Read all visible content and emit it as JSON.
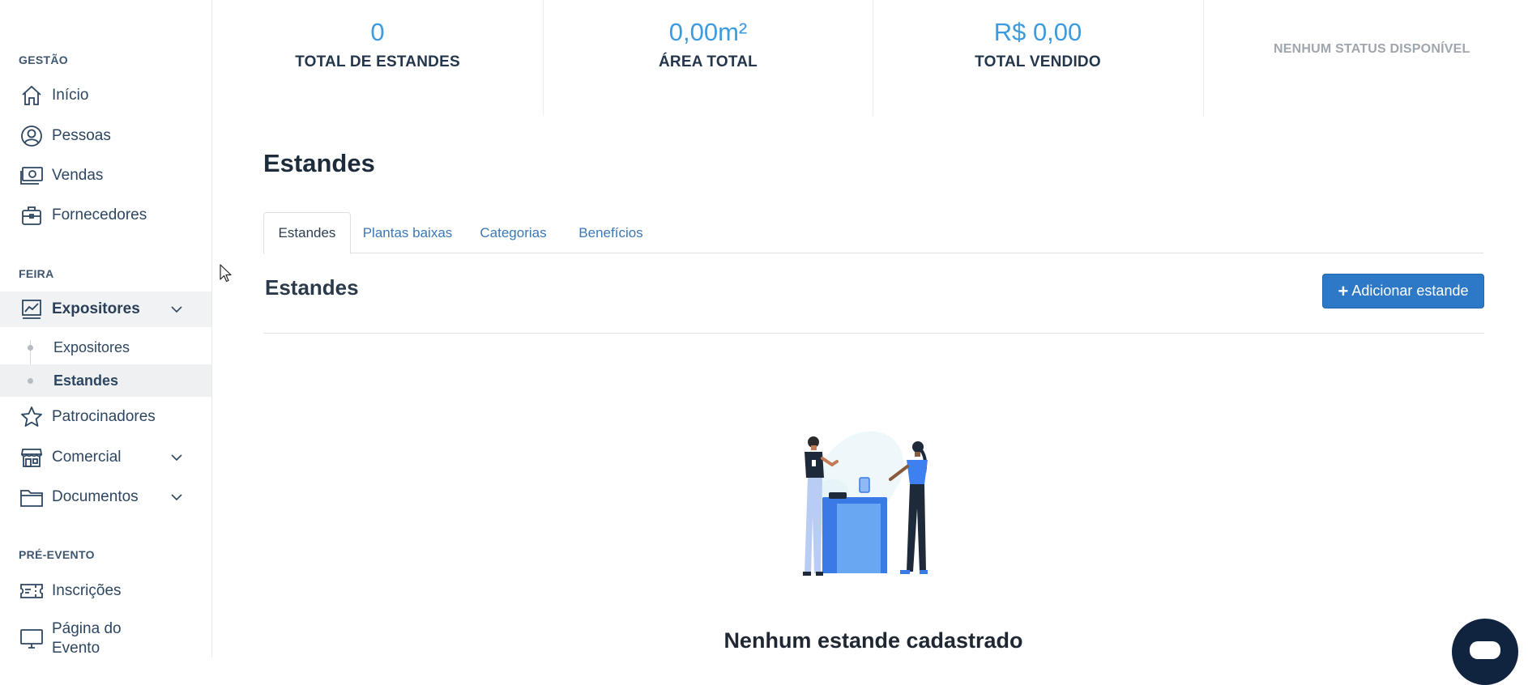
{
  "sidebar": {
    "sections": {
      "gestao": "GESTÃO",
      "feira": "FEIRA",
      "pre_evento": "PRÉ-EVENTO"
    },
    "items": {
      "inicio": "Início",
      "pessoas": "Pessoas",
      "vendas": "Vendas",
      "fornecedores": "Fornecedores",
      "expositores": "Expositores",
      "sub_expositores": "Expositores",
      "sub_estandes": "Estandes",
      "patrocinadores": "Patrocinadores",
      "comercial": "Comercial",
      "documentos": "Documentos",
      "inscricoes": "Inscrições",
      "pagina_line1": "Página do",
      "pagina_line2": "Evento"
    },
    "icons": {
      "inicio": "home-icon",
      "pessoas": "user-circle-icon",
      "vendas": "money-icon",
      "fornecedores": "briefcase-icon",
      "expositores": "chart-icon",
      "patrocinadores": "star-icon",
      "comercial": "store-icon",
      "documentos": "folder-icon",
      "inscricoes": "ticket-icon",
      "pagina": "monitor-icon"
    }
  },
  "stats": {
    "estandes": {
      "value": "0",
      "caption": "TOTAL DE ESTANDES"
    },
    "area": {
      "value": "0,00m²",
      "caption": "ÁREA TOTAL"
    },
    "vendido": {
      "value": "R$ 0,00",
      "caption": "TOTAL VENDIDO"
    },
    "status_empty": "NENHUM STATUS DISPONÍVEL"
  },
  "main": {
    "title": "Estandes",
    "tabs": [
      "Estandes",
      "Plantas baixas",
      "Categorias",
      "Benefícios"
    ],
    "section_title": "Estandes",
    "add_button": "Adicionar estande",
    "empty_state": "Nenhum estande cadastrado"
  },
  "colors": {
    "accent": "#3d9be0",
    "button": "#2d79c7",
    "chat": "#10233f"
  }
}
